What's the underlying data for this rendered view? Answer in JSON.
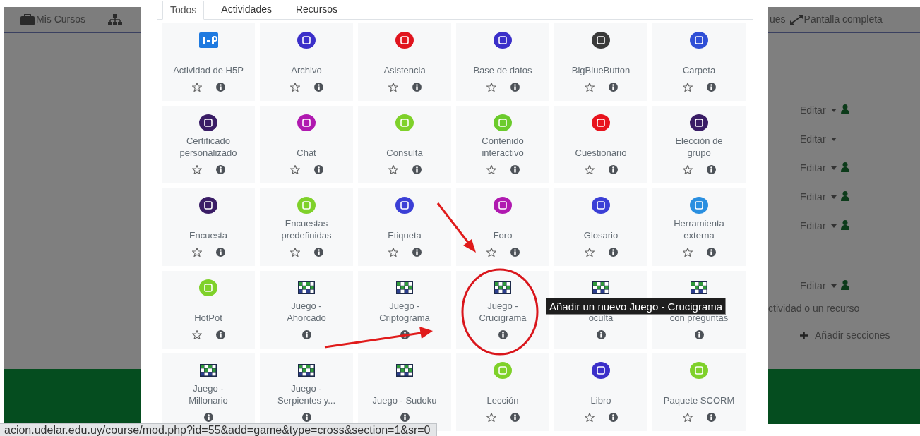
{
  "top_nav": {
    "left": [
      {
        "label": "Mis Cursos"
      }
    ],
    "right": [
      {
        "label": "ues"
      },
      {
        "label": "Pantalla completa"
      }
    ]
  },
  "modal": {
    "tabs": [
      {
        "label": "Todos",
        "selected": true
      },
      {
        "label": "Actividades",
        "selected": false
      },
      {
        "label": "Recursos",
        "selected": false
      }
    ],
    "modules": [
      {
        "label": "Actividad de H5P",
        "kind": "h5p",
        "color": "#1f7ae0",
        "star": true
      },
      {
        "label": "Archivo",
        "kind": "circle",
        "color": "#3b2fc9",
        "star": true
      },
      {
        "label": "Asistencia",
        "kind": "circle",
        "color": "#e0141e",
        "star": true
      },
      {
        "label": "Base de datos",
        "kind": "circle",
        "color": "#3b2fc9",
        "star": true
      },
      {
        "label": "BigBlueButton",
        "kind": "circle",
        "color": "#3a3a3a",
        "star": true
      },
      {
        "label": "Carpeta",
        "kind": "circle",
        "color": "#2f4fd6",
        "star": true
      },
      {
        "label": "Certificado personalizado",
        "kind": "circle",
        "color": "#3a1d66",
        "star": true
      },
      {
        "label": "Chat",
        "kind": "circle",
        "color": "#b019b0",
        "star": true
      },
      {
        "label": "Consulta",
        "kind": "circle",
        "color": "#7fd12a",
        "star": true
      },
      {
        "label": "Contenido interactivo",
        "kind": "circle",
        "color": "#6bcb2c",
        "star": true
      },
      {
        "label": "Cuestionario",
        "kind": "circle",
        "color": "#e8141e",
        "star": true
      },
      {
        "label": "Elección de grupo",
        "kind": "circle",
        "color": "#3a1d66",
        "star": true
      },
      {
        "label": "Encuesta",
        "kind": "circle",
        "color": "#3a1d66",
        "star": true
      },
      {
        "label": "Encuestas predefinidas",
        "kind": "circle",
        "color": "#7fd12a",
        "star": true
      },
      {
        "label": "Etiqueta",
        "kind": "circle",
        "color": "#3b3fd6",
        "star": true
      },
      {
        "label": "Foro",
        "kind": "circle",
        "color": "#b019b0",
        "star": true
      },
      {
        "label": "Glosario",
        "kind": "circle",
        "color": "#3b3fd6",
        "star": true
      },
      {
        "label": "Herramienta externa",
        "kind": "circle",
        "color": "#2a8fe0",
        "star": true
      },
      {
        "label": "HotPot",
        "kind": "circle",
        "color": "#7fd12a",
        "star": true
      },
      {
        "label": "Juego - Ahorcado",
        "kind": "game",
        "star": false
      },
      {
        "label": "Juego - Criptograma",
        "kind": "game",
        "star": false
      },
      {
        "label": "Juego - Crucigrama",
        "kind": "game",
        "star": false
      },
      {
        "label": "oculta",
        "kind": "game",
        "star": false
      },
      {
        "label": "con preguntas",
        "kind": "game",
        "star": false
      },
      {
        "label": "Juego - Millonario",
        "kind": "game",
        "star": false
      },
      {
        "label": "Juego - Serpientes y...",
        "kind": "game",
        "star": false
      },
      {
        "label": "Juego - Sudoku",
        "kind": "game",
        "star": false
      },
      {
        "label": "Lección",
        "kind": "circle",
        "color": "#7fd12a",
        "star": true
      },
      {
        "label": "Libro",
        "kind": "circle",
        "color": "#3b2fc9",
        "star": true
      },
      {
        "label": "Paquete SCORM",
        "kind": "circle",
        "color": "#7fd12a",
        "star": true
      }
    ]
  },
  "edit_rows": [
    {
      "label": "Editar",
      "user_icon": true
    },
    {
      "label": "Editar",
      "user_icon": false
    },
    {
      "label": "Editar",
      "user_icon": true
    },
    {
      "label": "Editar",
      "user_icon": true
    },
    {
      "label": "Editar",
      "user_icon": true
    },
    {
      "label": "Editar",
      "user_icon": true
    }
  ],
  "add_activity": "ctividad o un recurso",
  "add_sections": "Añadir secciones",
  "tooltip": "Añadir un nuevo Juego - Crucigrama",
  "status_url": "acion.udelar.edu.uy/course/mod.php?id=55&add=game&type=cross&section=1&sr=0"
}
